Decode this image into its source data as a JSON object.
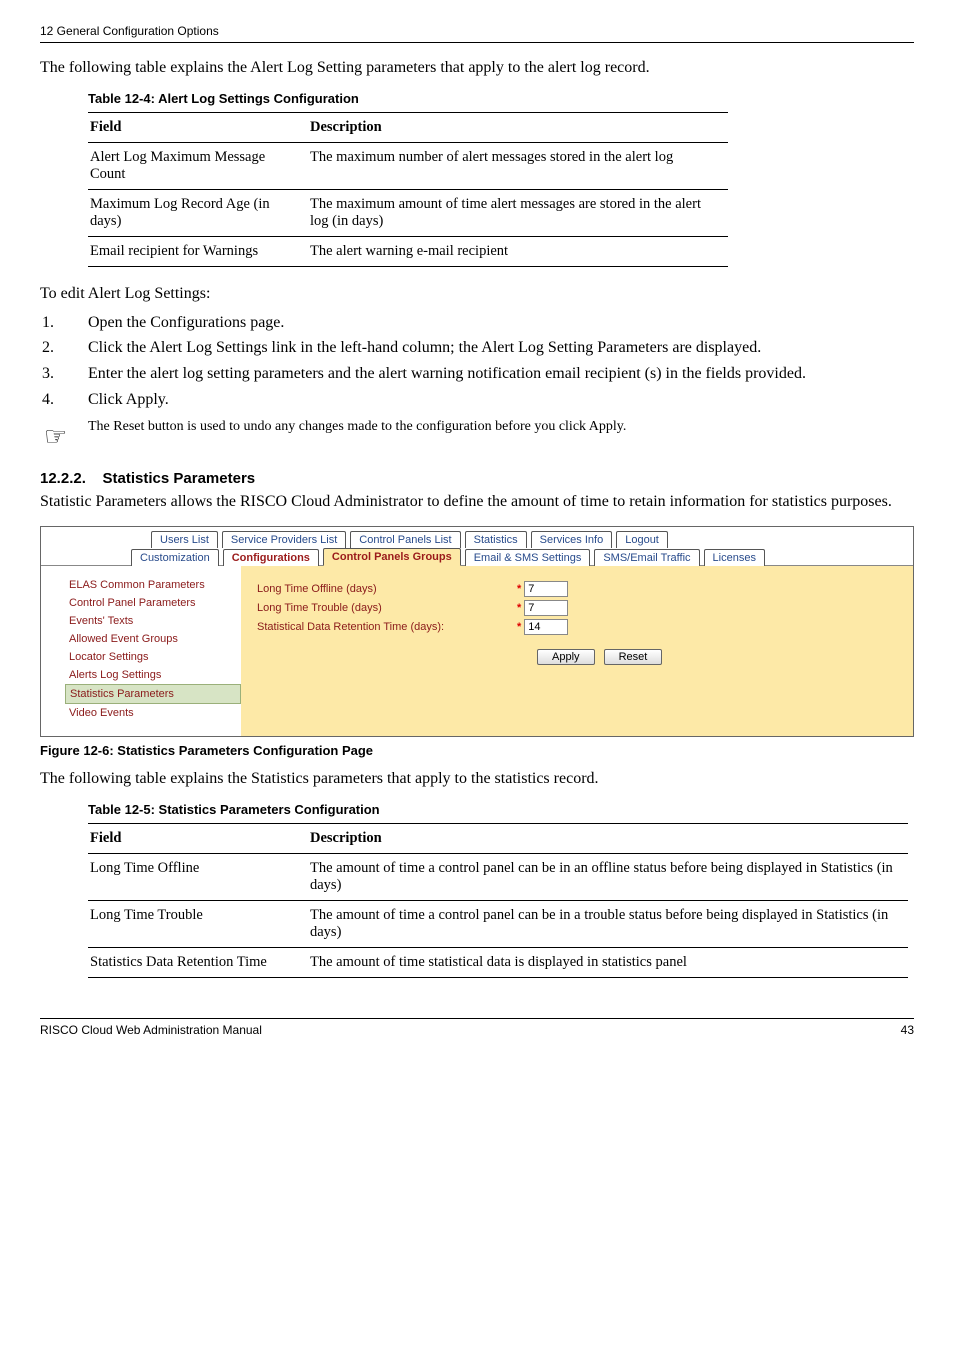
{
  "header": "12 General Configuration Options",
  "intro1": "The following table explains the Alert Log Setting parameters that apply to the alert log record.",
  "table1": {
    "caption": "Table 12-4: Alert Log Settings Configuration",
    "head_field": "Field",
    "head_desc": "Description",
    "rows": [
      {
        "field": "Alert Log Maximum Message Count",
        "desc": "The maximum number of alert messages stored in the alert log"
      },
      {
        "field": "Maximum Log Record Age (in days)",
        "desc": "The maximum amount of time alert messages are stored in the alert log (in days)"
      },
      {
        "field": "Email recipient for Warnings",
        "desc": "The alert warning e-mail recipient"
      }
    ]
  },
  "edit_intro": "To edit Alert Log Settings:",
  "steps": [
    {
      "n": "1.",
      "t": "Open the Configurations page."
    },
    {
      "n": "2.",
      "t": "Click the Alert Log Settings link in the left-hand column; the Alert Log Setting Parameters are displayed."
    },
    {
      "n": "3.",
      "t": "Enter the alert log setting parameters and the alert warning notification email recipient (s) in the fields provided."
    },
    {
      "n": "4.",
      "t": "Click Apply."
    }
  ],
  "note": "The Reset button is used to undo any changes made to the configuration before you click Apply.",
  "section_num": "12.2.2.",
  "section_title": "Statistics Parameters",
  "stats_intro": "Statistic Parameters allows the RISCO Cloud Administrator to define the amount of time to retain information for statistics purposes.",
  "tabs_top": [
    "Users List",
    "Service Providers List",
    "Control Panels List",
    "Statistics",
    "Services Info",
    "Logout"
  ],
  "tabs_bottom": [
    "Customization",
    "Configurations",
    "Control Panels Groups",
    "Email & SMS Settings",
    "SMS/Email Traffic",
    "Licenses"
  ],
  "sidebar_items": [
    "ELAS Common Parameters",
    "Control Panel Parameters",
    "Events' Texts",
    "Allowed Event Groups",
    "Locator Settings",
    "Alerts Log Settings",
    "Statistics Parameters",
    "Video Events"
  ],
  "params": [
    {
      "label": "Long Time Offline (days)",
      "value": "7"
    },
    {
      "label": "Long Time Trouble (days)",
      "value": "7"
    },
    {
      "label": "Statistical Data Retention Time (days):",
      "value": "14"
    }
  ],
  "btn_apply": "Apply",
  "btn_reset": "Reset",
  "fig_caption": "Figure 12-6: Statistics Parameters Configuration Page",
  "intro2": "The following table explains the Statistics parameters that apply to the statistics record.",
  "table2": {
    "caption": "Table 12-5: Statistics Parameters Configuration",
    "head_field": "Field",
    "head_desc": "Description",
    "rows": [
      {
        "field": "Long Time Offline",
        "desc": "The amount of time a control panel can be in an offline status before being displayed in Statistics (in days)"
      },
      {
        "field": "Long Time Trouble",
        "desc": "The amount of time a control panel can be in a trouble status before being displayed in Statistics (in days)"
      },
      {
        "field": "Statistics Data Retention Time",
        "desc": "The amount of time statistical data is displayed in statistics panel"
      }
    ]
  },
  "footer_left": "RISCO Cloud Web Administration Manual",
  "footer_right": "43"
}
